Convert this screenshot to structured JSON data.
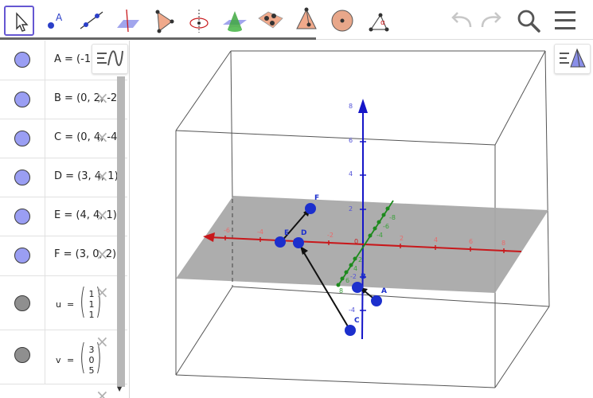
{
  "toolbar": {
    "tools": [
      {
        "name": "move-tool",
        "icon": "cursor-arrow-icon",
        "selected": true
      },
      {
        "name": "point-tool",
        "icon": "point-icon",
        "label": "A"
      },
      {
        "name": "line-tool",
        "icon": "line-icon"
      },
      {
        "name": "perpendicular-line-tool",
        "icon": "perpendicular-plane-icon"
      },
      {
        "name": "polygon-tool",
        "icon": "polygon-icon"
      },
      {
        "name": "circle-axis-tool",
        "icon": "circle-axis-icon"
      },
      {
        "name": "plane-tool",
        "icon": "plane-icon"
      },
      {
        "name": "plane-three-points-tool",
        "icon": "three-points-plane-icon"
      },
      {
        "name": "pyramid-tool",
        "icon": "pyramid-icon"
      },
      {
        "name": "sphere-tool",
        "icon": "sphere-icon"
      },
      {
        "name": "rotate-tool",
        "icon": "rotate-around-point-icon"
      }
    ],
    "undo_icon": "undo-icon",
    "redo_icon": "redo-icon",
    "search_icon": "search-icon",
    "menu_icon": "hamburger-menu-icon"
  },
  "algebra": {
    "style_bar_icon": "algebra-style-icon",
    "rows": [
      {
        "text": "A = (-1",
        "color": "#9a9ef3",
        "close": "×"
      },
      {
        "text": "B = (0, 2, -2",
        "color": "#9a9ef3",
        "close": "×"
      },
      {
        "text": "C = (0, 4, -4",
        "color": "#9a9ef3",
        "close": "×"
      },
      {
        "text": "D = (3, 4, 1)",
        "color": "#9a9ef3",
        "close": "×"
      },
      {
        "text": "E = (4, 4, 1)",
        "color": "#9a9ef3",
        "close": "×"
      },
      {
        "text": "F = (3, 0, 2)",
        "color": "#9a9ef3",
        "close": "×"
      }
    ],
    "vectors": [
      {
        "name": "u",
        "eq": "=",
        "components": [
          "1",
          "1",
          "1"
        ],
        "color": "#8f8f8f",
        "close": "×"
      },
      {
        "name": "v",
        "eq": "=",
        "components": [
          "3",
          "0",
          "5"
        ],
        "color": "#8f8f8f",
        "close": "×"
      }
    ]
  },
  "graphics": {
    "style_bar_icon": "graphics-3d-style-icon",
    "axis_colors": {
      "x": "#c8181b",
      "y": "#1d8a1d",
      "z": "#1515c8"
    },
    "z_ticks": [
      "8",
      "6",
      "4",
      "2",
      "-2",
      "-4"
    ],
    "x_ticks": [
      "-6",
      "-4",
      "-2",
      "2",
      "4",
      "6",
      "8"
    ],
    "y_ticks": [
      "-8",
      "-6",
      "-4",
      "2",
      "4",
      "6",
      "8"
    ],
    "point_labels": [
      "F",
      "E",
      "D",
      "A",
      "C",
      "B"
    ],
    "origin_label": "0"
  }
}
